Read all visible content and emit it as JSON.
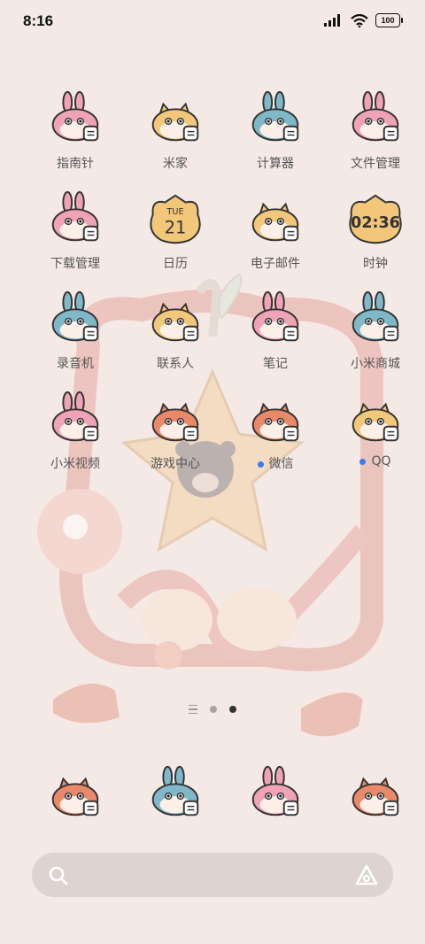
{
  "status": {
    "time": "8:16",
    "battery": "100"
  },
  "apps": [
    {
      "label": "指南针",
      "icon": "compass-app-icon",
      "style": "pink"
    },
    {
      "label": "米家",
      "icon": "mijia-app-icon",
      "style": "yellow"
    },
    {
      "label": "计算器",
      "icon": "calculator-app-icon",
      "style": "teal"
    },
    {
      "label": "文件管理",
      "icon": "file-manager-app-icon",
      "style": "pink"
    },
    {
      "label": "下载管理",
      "icon": "download-manager-app-icon",
      "style": "pink"
    },
    {
      "label": "日历",
      "icon": "calendar-app-icon",
      "style": "calendar",
      "day": "TUE",
      "date": "21"
    },
    {
      "label": "电子邮件",
      "icon": "email-app-icon",
      "style": "yellow"
    },
    {
      "label": "时钟",
      "icon": "clock-app-icon",
      "style": "clock",
      "clock": "02:36"
    },
    {
      "label": "录音机",
      "icon": "recorder-app-icon",
      "style": "teal"
    },
    {
      "label": "联系人",
      "icon": "contacts-app-icon",
      "style": "yellow"
    },
    {
      "label": "笔记",
      "icon": "notes-app-icon",
      "style": "pink"
    },
    {
      "label": "小米商城",
      "icon": "mi-store-app-icon",
      "style": "teal"
    },
    {
      "label": "小米视频",
      "icon": "mi-video-app-icon",
      "style": "pink"
    },
    {
      "label": "游戏中心",
      "icon": "game-center-app-icon",
      "style": "orange"
    },
    {
      "label": "微信",
      "icon": "wechat-app-icon",
      "style": "orange",
      "badge": true
    },
    {
      "label": "QQ",
      "icon": "qq-app-icon",
      "style": "yellow",
      "badge": true
    }
  ],
  "dock": [
    {
      "icon": "phone-app-icon",
      "style": "orange"
    },
    {
      "icon": "browser-app-icon",
      "style": "teal"
    },
    {
      "icon": "messages-app-icon",
      "style": "pink"
    },
    {
      "icon": "camera-app-icon",
      "style": "orange"
    }
  ],
  "colors": {
    "background": "#f4e9e4",
    "badge": "#3a7cf0",
    "pink": "#f0a3b4",
    "teal": "#7fb8c9",
    "yellow": "#f3c77a",
    "orange": "#e9896a"
  }
}
